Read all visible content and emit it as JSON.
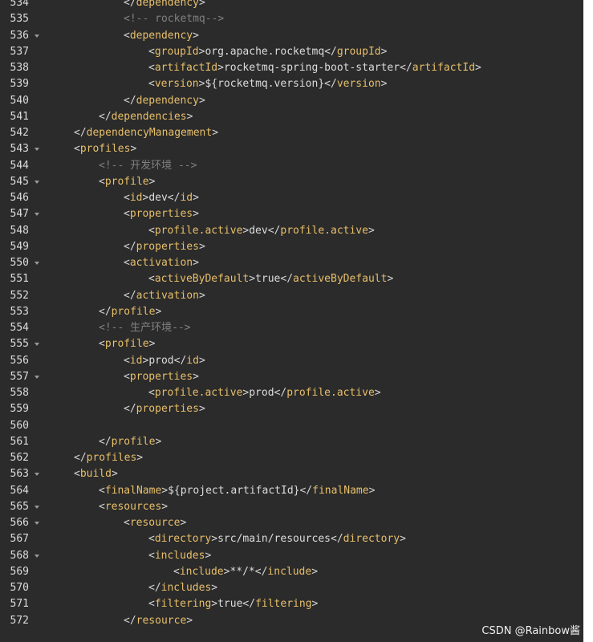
{
  "editor": {
    "lines": [
      {
        "no": "534",
        "indent": 3,
        "fold": false,
        "tokens": [
          [
            "p",
            "</"
          ],
          [
            "t",
            "dependency"
          ],
          [
            "p",
            ">"
          ]
        ]
      },
      {
        "no": "535",
        "indent": 3,
        "fold": false,
        "tokens": [
          [
            "c",
            "<!-- rocketmq-->"
          ]
        ]
      },
      {
        "no": "536",
        "indent": 3,
        "fold": true,
        "tokens": [
          [
            "p",
            "<"
          ],
          [
            "t",
            "dependency"
          ],
          [
            "p",
            ">"
          ]
        ]
      },
      {
        "no": "537",
        "indent": 4,
        "fold": false,
        "tokens": [
          [
            "p",
            "<"
          ],
          [
            "t",
            "groupId"
          ],
          [
            "p",
            ">"
          ],
          [
            "x",
            "org.apache.rocketmq"
          ],
          [
            "p",
            "</"
          ],
          [
            "t",
            "groupId"
          ],
          [
            "p",
            ">"
          ]
        ]
      },
      {
        "no": "538",
        "indent": 4,
        "fold": false,
        "tokens": [
          [
            "p",
            "<"
          ],
          [
            "t",
            "artifactId"
          ],
          [
            "p",
            ">"
          ],
          [
            "x",
            "rocketmq-spring-boot-starter"
          ],
          [
            "p",
            "</"
          ],
          [
            "t",
            "artifactId"
          ],
          [
            "p",
            ">"
          ]
        ]
      },
      {
        "no": "539",
        "indent": 4,
        "fold": false,
        "tokens": [
          [
            "p",
            "<"
          ],
          [
            "t",
            "version"
          ],
          [
            "p",
            ">"
          ],
          [
            "x",
            "${rocketmq.version}"
          ],
          [
            "p",
            "</"
          ],
          [
            "t",
            "version"
          ],
          [
            "p",
            ">"
          ]
        ]
      },
      {
        "no": "540",
        "indent": 3,
        "fold": false,
        "tokens": [
          [
            "p",
            "</"
          ],
          [
            "t",
            "dependency"
          ],
          [
            "p",
            ">"
          ]
        ]
      },
      {
        "no": "541",
        "indent": 2,
        "fold": false,
        "tokens": [
          [
            "p",
            "</"
          ],
          [
            "t",
            "dependencies"
          ],
          [
            "p",
            ">"
          ]
        ]
      },
      {
        "no": "542",
        "indent": 1,
        "fold": false,
        "tokens": [
          [
            "p",
            "</"
          ],
          [
            "t",
            "dependencyManagement"
          ],
          [
            "p",
            ">"
          ]
        ]
      },
      {
        "no": "543",
        "indent": 1,
        "fold": true,
        "tokens": [
          [
            "p",
            "<"
          ],
          [
            "t",
            "profiles"
          ],
          [
            "p",
            ">"
          ]
        ]
      },
      {
        "no": "544",
        "indent": 2,
        "fold": false,
        "tokens": [
          [
            "c",
            "<!-- 开发环境 -->"
          ]
        ]
      },
      {
        "no": "545",
        "indent": 2,
        "fold": true,
        "tokens": [
          [
            "p",
            "<"
          ],
          [
            "t",
            "profile"
          ],
          [
            "p",
            ">"
          ]
        ]
      },
      {
        "no": "546",
        "indent": 3,
        "fold": false,
        "tokens": [
          [
            "p",
            "<"
          ],
          [
            "t",
            "id"
          ],
          [
            "p",
            ">"
          ],
          [
            "x",
            "dev"
          ],
          [
            "p",
            "</"
          ],
          [
            "t",
            "id"
          ],
          [
            "p",
            ">"
          ]
        ]
      },
      {
        "no": "547",
        "indent": 3,
        "fold": true,
        "tokens": [
          [
            "p",
            "<"
          ],
          [
            "t",
            "properties"
          ],
          [
            "p",
            ">"
          ]
        ]
      },
      {
        "no": "548",
        "indent": 4,
        "fold": false,
        "tokens": [
          [
            "p",
            "<"
          ],
          [
            "t",
            "profile.active"
          ],
          [
            "p",
            ">"
          ],
          [
            "x",
            "dev"
          ],
          [
            "p",
            "</"
          ],
          [
            "t",
            "profile.active"
          ],
          [
            "p",
            ">"
          ]
        ]
      },
      {
        "no": "549",
        "indent": 3,
        "fold": false,
        "tokens": [
          [
            "p",
            "</"
          ],
          [
            "t",
            "properties"
          ],
          [
            "p",
            ">"
          ]
        ]
      },
      {
        "no": "550",
        "indent": 3,
        "fold": true,
        "tokens": [
          [
            "p",
            "<"
          ],
          [
            "t",
            "activation"
          ],
          [
            "p",
            ">"
          ]
        ]
      },
      {
        "no": "551",
        "indent": 4,
        "fold": false,
        "tokens": [
          [
            "p",
            "<"
          ],
          [
            "t",
            "activeByDefault"
          ],
          [
            "p",
            ">"
          ],
          [
            "x",
            "true"
          ],
          [
            "p",
            "</"
          ],
          [
            "t",
            "activeByDefault"
          ],
          [
            "p",
            ">"
          ]
        ]
      },
      {
        "no": "552",
        "indent": 3,
        "fold": false,
        "tokens": [
          [
            "p",
            "</"
          ],
          [
            "t",
            "activation"
          ],
          [
            "p",
            ">"
          ]
        ]
      },
      {
        "no": "553",
        "indent": 2,
        "fold": false,
        "tokens": [
          [
            "p",
            "</"
          ],
          [
            "t",
            "profile"
          ],
          [
            "p",
            ">"
          ]
        ]
      },
      {
        "no": "554",
        "indent": 2,
        "fold": false,
        "tokens": [
          [
            "c",
            "<!-- 生产环境-->"
          ]
        ]
      },
      {
        "no": "555",
        "indent": 2,
        "fold": true,
        "tokens": [
          [
            "p",
            "<"
          ],
          [
            "t",
            "profile"
          ],
          [
            "p",
            ">"
          ]
        ]
      },
      {
        "no": "556",
        "indent": 3,
        "fold": false,
        "tokens": [
          [
            "p",
            "<"
          ],
          [
            "t",
            "id"
          ],
          [
            "p",
            ">"
          ],
          [
            "x",
            "prod"
          ],
          [
            "p",
            "</"
          ],
          [
            "t",
            "id"
          ],
          [
            "p",
            ">"
          ]
        ]
      },
      {
        "no": "557",
        "indent": 3,
        "fold": true,
        "tokens": [
          [
            "p",
            "<"
          ],
          [
            "t",
            "properties"
          ],
          [
            "p",
            ">"
          ]
        ]
      },
      {
        "no": "558",
        "indent": 4,
        "fold": false,
        "tokens": [
          [
            "p",
            "<"
          ],
          [
            "t",
            "profile.active"
          ],
          [
            "p",
            ">"
          ],
          [
            "x",
            "prod"
          ],
          [
            "p",
            "</"
          ],
          [
            "t",
            "profile.active"
          ],
          [
            "p",
            ">"
          ]
        ]
      },
      {
        "no": "559",
        "indent": 3,
        "fold": false,
        "tokens": [
          [
            "p",
            "</"
          ],
          [
            "t",
            "properties"
          ],
          [
            "p",
            ">"
          ]
        ]
      },
      {
        "no": "560",
        "indent": 0,
        "fold": false,
        "tokens": []
      },
      {
        "no": "561",
        "indent": 2,
        "fold": false,
        "tokens": [
          [
            "p",
            "</"
          ],
          [
            "t",
            "profile"
          ],
          [
            "p",
            ">"
          ]
        ]
      },
      {
        "no": "562",
        "indent": 1,
        "fold": false,
        "tokens": [
          [
            "p",
            "</"
          ],
          [
            "t",
            "profiles"
          ],
          [
            "p",
            ">"
          ]
        ]
      },
      {
        "no": "563",
        "indent": 1,
        "fold": true,
        "tokens": [
          [
            "p",
            "<"
          ],
          [
            "t",
            "build"
          ],
          [
            "p",
            ">"
          ]
        ]
      },
      {
        "no": "564",
        "indent": 2,
        "fold": false,
        "tokens": [
          [
            "p",
            "<"
          ],
          [
            "t",
            "finalName"
          ],
          [
            "p",
            ">"
          ],
          [
            "x",
            "${project.artifactId}"
          ],
          [
            "p",
            "</"
          ],
          [
            "t",
            "finalName"
          ],
          [
            "p",
            ">"
          ]
        ]
      },
      {
        "no": "565",
        "indent": 2,
        "fold": true,
        "tokens": [
          [
            "p",
            "<"
          ],
          [
            "t",
            "resources"
          ],
          [
            "p",
            ">"
          ]
        ]
      },
      {
        "no": "566",
        "indent": 3,
        "fold": true,
        "tokens": [
          [
            "p",
            "<"
          ],
          [
            "t",
            "resource"
          ],
          [
            "p",
            ">"
          ]
        ]
      },
      {
        "no": "567",
        "indent": 4,
        "fold": false,
        "tokens": [
          [
            "p",
            "<"
          ],
          [
            "t",
            "directory"
          ],
          [
            "p",
            ">"
          ],
          [
            "x",
            "src/main/resources"
          ],
          [
            "p",
            "</"
          ],
          [
            "t",
            "directory"
          ],
          [
            "p",
            ">"
          ]
        ]
      },
      {
        "no": "568",
        "indent": 4,
        "fold": true,
        "tokens": [
          [
            "p",
            "<"
          ],
          [
            "t",
            "includes"
          ],
          [
            "p",
            ">"
          ]
        ]
      },
      {
        "no": "569",
        "indent": 5,
        "fold": false,
        "tokens": [
          [
            "p",
            "<"
          ],
          [
            "t",
            "include"
          ],
          [
            "p",
            ">"
          ],
          [
            "x",
            "**/*"
          ],
          [
            "p",
            "</"
          ],
          [
            "t",
            "include"
          ],
          [
            "p",
            ">"
          ]
        ]
      },
      {
        "no": "570",
        "indent": 4,
        "fold": false,
        "tokens": [
          [
            "p",
            "</"
          ],
          [
            "t",
            "includes"
          ],
          [
            "p",
            ">"
          ]
        ]
      },
      {
        "no": "571",
        "indent": 4,
        "fold": false,
        "tokens": [
          [
            "p",
            "<"
          ],
          [
            "t",
            "filtering"
          ],
          [
            "p",
            ">"
          ],
          [
            "x",
            "true"
          ],
          [
            "p",
            "</"
          ],
          [
            "t",
            "filtering"
          ],
          [
            "p",
            ">"
          ]
        ]
      },
      {
        "no": "572",
        "indent": 3,
        "fold": false,
        "tokens": [
          [
            "p",
            "</"
          ],
          [
            "t",
            "resource"
          ],
          [
            "p",
            ">"
          ]
        ]
      }
    ]
  },
  "watermark": "CSDN @Rainbow酱",
  "colors": {
    "background": "#2b2b2b",
    "tag": "#e8bf6a",
    "text": "#dcdcdc",
    "comment": "#808080"
  }
}
